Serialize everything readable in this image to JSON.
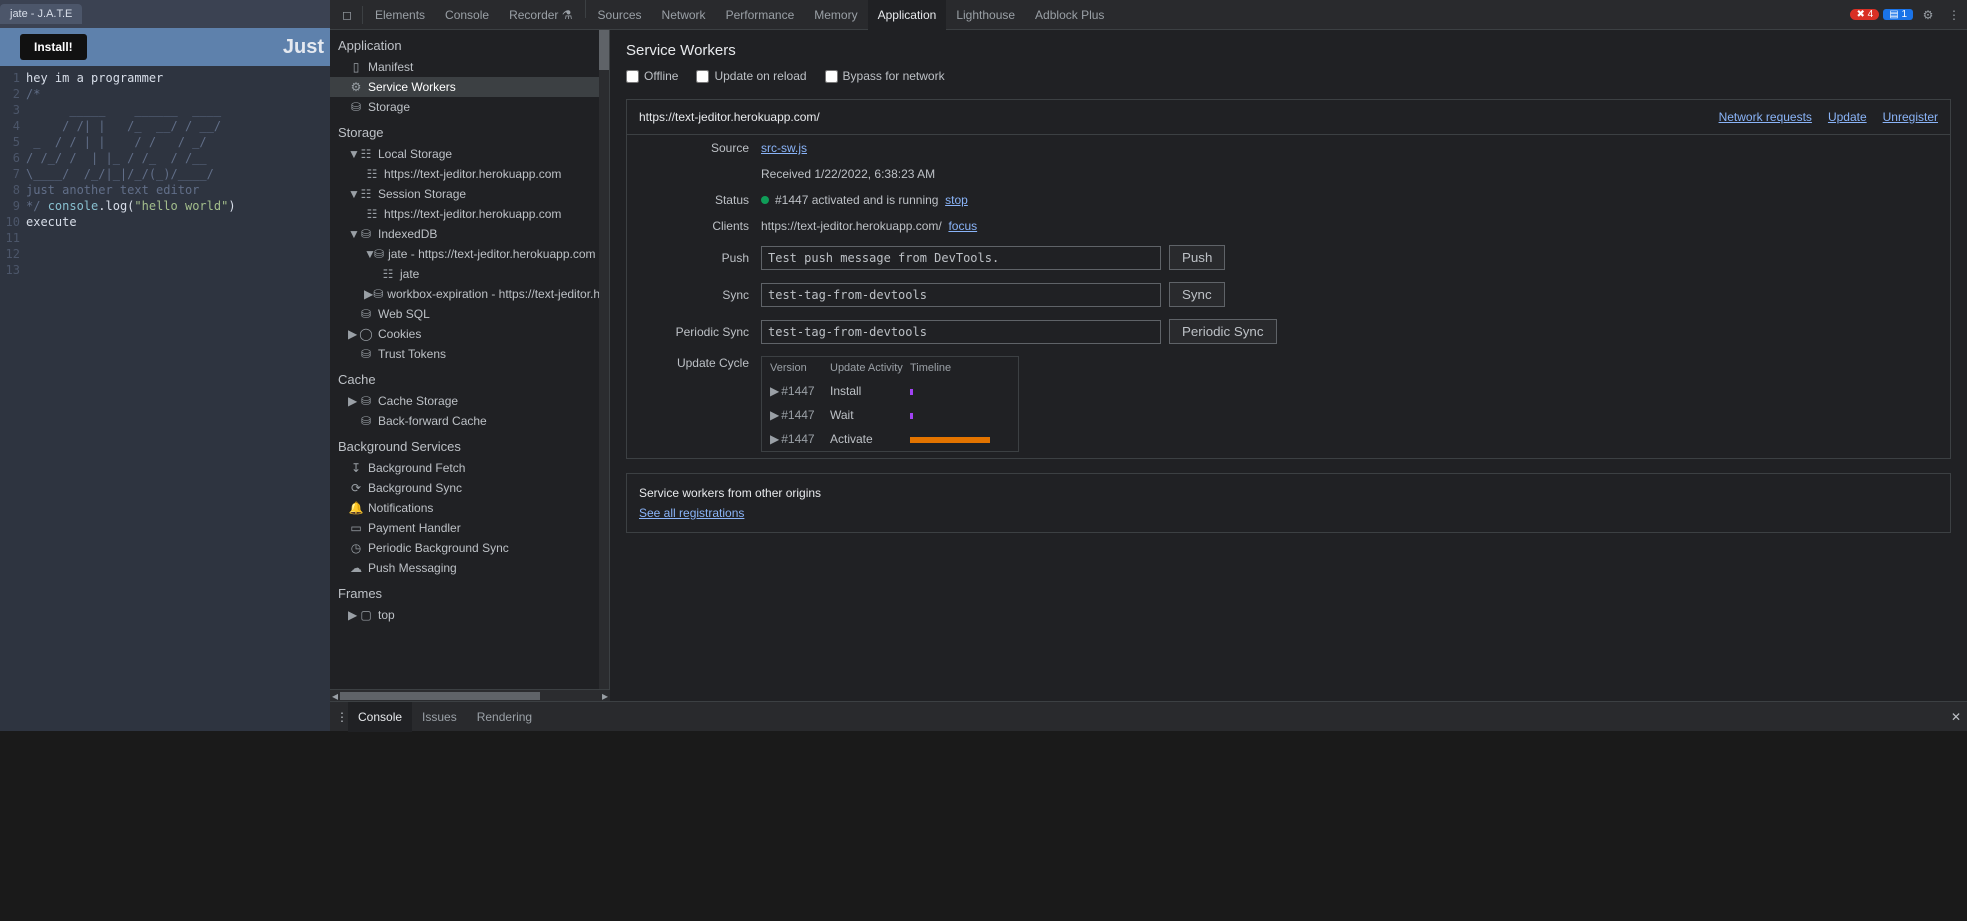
{
  "browser_tab": "jate - J.A.T.E",
  "app": {
    "install": "Install!",
    "header_title": "Just"
  },
  "editor": {
    "lines": [
      {
        "n": "1",
        "cls": "",
        "t": "hey im a programmer"
      },
      {
        "n": "2",
        "cls": "c-comment",
        "t": "/*"
      },
      {
        "n": "3",
        "cls": "c-comment",
        "t": "      _____    ______  ____"
      },
      {
        "n": "4",
        "cls": "c-comment",
        "t": "     / /| |   /_  __/ / __/"
      },
      {
        "n": "5",
        "cls": "c-comment",
        "t": " _  / / | |    / /   / _/"
      },
      {
        "n": "6",
        "cls": "c-comment",
        "t": "/ /_/ /  | |_ / /_  / /__"
      },
      {
        "n": "7",
        "cls": "c-comment",
        "t": "\\____/  /_/|_|/_/(_)/____/"
      },
      {
        "n": "8",
        "cls": "c-comment",
        "t": "just another text editor"
      },
      {
        "n": "9",
        "cls": "",
        "html": "<span class='c-comment'>*/</span> <span class='c-keyword'>console</span>.log(<span class='c-string'>\"hello world\"</span>)"
      },
      {
        "n": "10",
        "cls": "",
        "t": "execute"
      },
      {
        "n": "11",
        "cls": "",
        "t": ""
      },
      {
        "n": "12",
        "cls": "",
        "t": ""
      },
      {
        "n": "13",
        "cls": "",
        "t": ""
      }
    ]
  },
  "devtools": {
    "tabs": [
      "Elements",
      "Console",
      "Recorder ⚗",
      "",
      "Sources",
      "Network",
      "Performance",
      "Memory",
      "Application",
      "Lighthouse",
      "Adblock Plus"
    ],
    "active_tab": "Application",
    "errors": "4",
    "issues": "1"
  },
  "sidebar": {
    "g_application": "Application",
    "manifest": "Manifest",
    "service_workers": "Service Workers",
    "storage": "Storage",
    "g_storage": "Storage",
    "local_storage": "Local Storage",
    "ls_origin": "https://text-jeditor.herokuapp.com",
    "session_storage": "Session Storage",
    "ss_origin": "https://text-jeditor.herokuapp.com",
    "indexeddb": "IndexedDB",
    "idb_jate": "jate - https://text-jeditor.herokuapp.com",
    "idb_jate_store": "jate",
    "idb_workbox": "workbox-expiration - https://text-jeditor.h",
    "websql": "Web SQL",
    "cookies": "Cookies",
    "trust_tokens": "Trust Tokens",
    "g_cache": "Cache",
    "cache_storage": "Cache Storage",
    "bf_cache": "Back-forward Cache",
    "g_bg": "Background Services",
    "bg_fetch": "Background Fetch",
    "bg_sync": "Background Sync",
    "notifications": "Notifications",
    "payment": "Payment Handler",
    "periodic_bg_sync": "Periodic Background Sync",
    "push": "Push Messaging",
    "g_frames": "Frames",
    "frame_top": "top"
  },
  "main": {
    "title": "Service Workers",
    "opt_offline": "Offline",
    "opt_update": "Update on reload",
    "opt_bypass": "Bypass for network",
    "origin": "https://text-jeditor.herokuapp.com/",
    "link_netreq": "Network requests",
    "link_update": "Update",
    "link_unregister": "Unregister",
    "source_k": "Source",
    "source_v": "src-sw.js",
    "received": "Received 1/22/2022, 6:38:23 AM",
    "status_k": "Status",
    "status_v": "#1447 activated and is running",
    "status_stop": "stop",
    "clients_k": "Clients",
    "clients_v": "https://text-jeditor.herokuapp.com/",
    "clients_focus": "focus",
    "push_k": "Push",
    "push_val": "Test push message from DevTools.",
    "push_btn": "Push",
    "sync_k": "Sync",
    "sync_val": "test-tag-from-devtools",
    "sync_btn": "Sync",
    "psync_k": "Periodic Sync",
    "psync_val": "test-tag-from-devtools",
    "psync_btn": "Periodic Sync",
    "cycle_k": "Update Cycle",
    "cycle_h1": "Version",
    "cycle_h2": "Update Activity",
    "cycle_h3": "Timeline",
    "cycle_rows": [
      {
        "v": "#1447",
        "a": "Install",
        "bar": "small"
      },
      {
        "v": "#1447",
        "a": "Wait",
        "bar": "small"
      },
      {
        "v": "#1447",
        "a": "Activate",
        "bar": "big"
      }
    ],
    "other_title": "Service workers from other origins",
    "other_link": "See all registrations"
  },
  "drawer": {
    "console": "Console",
    "issues": "Issues",
    "rendering": "Rendering"
  }
}
